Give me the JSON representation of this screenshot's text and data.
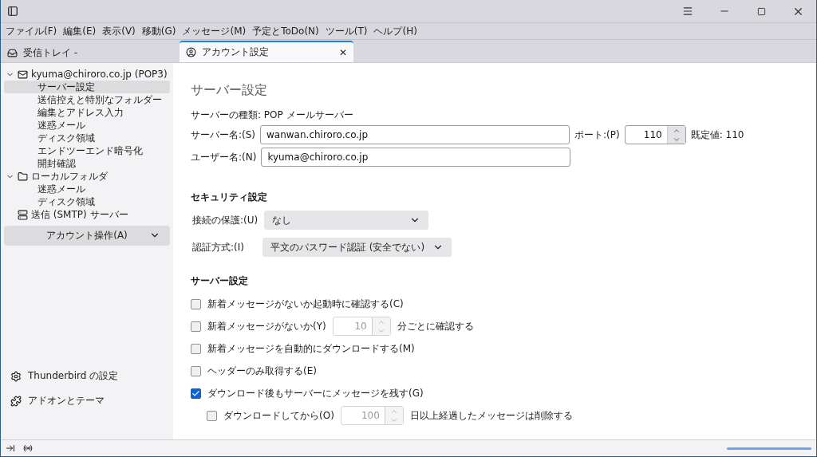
{
  "menu": [
    "ファイル(F)",
    "編集(E)",
    "表示(V)",
    "移動(G)",
    "メッセージ(M)",
    "予定とToDo(N)",
    "ツール(T)",
    "ヘルプ(H)"
  ],
  "tabs": [
    {
      "label": "受信トレイ -",
      "kind": "inbox",
      "selected": false
    },
    {
      "label": "アカウント設定",
      "kind": "settings",
      "selected": true,
      "close": "✕"
    }
  ],
  "sidebar": {
    "tree": [
      {
        "label": "kyuma@chiroro.co.jp (POP3)",
        "kind": "account",
        "expanded": true,
        "selected": false,
        "children": [
          {
            "label": "サーバー設定",
            "selected": true
          },
          {
            "label": "送信控えと特別なフォルダー",
            "selected": false
          },
          {
            "label": "編集とアドレス入力",
            "selected": false
          },
          {
            "label": "迷惑メール",
            "selected": false
          },
          {
            "label": "ディスク領域",
            "selected": false
          },
          {
            "label": "エンドツーエンド暗号化",
            "selected": false
          },
          {
            "label": "開封確認",
            "selected": false
          }
        ]
      },
      {
        "label": "ローカルフォルダ",
        "kind": "folder",
        "expanded": true,
        "selected": false,
        "children": [
          {
            "label": "迷惑メール",
            "selected": false
          },
          {
            "label": "ディスク領域",
            "selected": false
          }
        ]
      },
      {
        "label": "送信 (SMTP) サーバー",
        "kind": "smtp",
        "selected": false
      }
    ],
    "account_actions": "アカウント操作(A)",
    "footer": [
      {
        "label": "Thunderbird の設定",
        "kind": "gear"
      },
      {
        "label": "アドオンとテーマ",
        "kind": "addon"
      }
    ]
  },
  "content": {
    "title": "サーバー設定",
    "server_type": "サーバーの種類: POP メールサーバー",
    "server_name": {
      "label": "サーバー名:(S)",
      "value": "wanwan.chiroro.co.jp"
    },
    "port": {
      "label": "ポート:(P)",
      "value": "110",
      "default": "既定値: 110"
    },
    "user_name": {
      "label": "ユーザー名:(N)",
      "value": "kyuma@chiroro.co.jp"
    },
    "security": {
      "heading": "セキュリティ設定",
      "rows": [
        {
          "label": "接続の保護:(U)",
          "value": "なし"
        },
        {
          "label": "認証方式:(I)",
          "value": "平文のパスワード認証 (安全でない)"
        }
      ]
    },
    "server_settings": {
      "heading": "サーバー設定",
      "options": [
        {
          "kind": "check",
          "label": "新着メッセージがないか起動時に確認する(C)",
          "checked": false
        },
        {
          "kind": "interval",
          "label": "新着メッセージがないか(Y)",
          "checked": false,
          "value": "10",
          "suffix": "分ごとに確認する",
          "disabled": true
        },
        {
          "kind": "check",
          "label": "新着メッセージを自動的にダウンロードする(M)",
          "checked": false
        },
        {
          "kind": "check",
          "label": "ヘッダーのみ取得する(E)",
          "checked": false
        },
        {
          "kind": "check",
          "label": "ダウンロード後もサーバーにメッセージを残す(G)",
          "checked": true,
          "children": [
            {
              "kind": "interval",
              "label": "ダウンロードしてから(O)",
              "checked": false,
              "value": "100",
              "suffix": "日以上経過したメッセージは削除する",
              "disabled": true
            }
          ]
        }
      ]
    }
  },
  "status_bar": {
    "progress": {
      "level": 1
    }
  }
}
